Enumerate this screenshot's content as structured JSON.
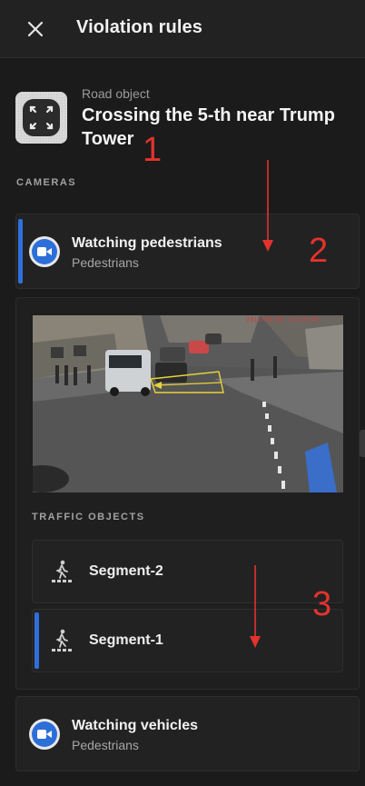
{
  "header": {
    "title": "Violation rules",
    "close_icon": "close-icon"
  },
  "road_object": {
    "label": "Road object",
    "name": "Crossing the 5-th near Trump Tower",
    "thumbnail_icon": "expand-arrows-icon"
  },
  "cameras": {
    "section_label": "CAMERAS",
    "items": [
      {
        "title": "Watching pedestrians",
        "subtitle": "Pedestrians",
        "icon": "camera-icon",
        "selected": true
      },
      {
        "title": "Watching vehicles",
        "subtitle": "Pedestrians",
        "icon": "camera-icon",
        "selected": false
      }
    ]
  },
  "camera_view": {
    "timestamp": "2012/08/02 13:48:00"
  },
  "traffic_objects": {
    "section_label": "TRAFFIC OBJECTS",
    "items": [
      {
        "label": "Segment-2",
        "icon": "pedestrian-crossing-icon",
        "selected": false
      },
      {
        "label": "Segment-1",
        "icon": "pedestrian-crossing-icon",
        "selected": true
      }
    ]
  },
  "annotations": [
    "1",
    "2",
    "3"
  ],
  "colors": {
    "accent": "#2f6fdb",
    "background": "#1b1b1b",
    "card": "#222222",
    "annotation": "#e2332e"
  }
}
